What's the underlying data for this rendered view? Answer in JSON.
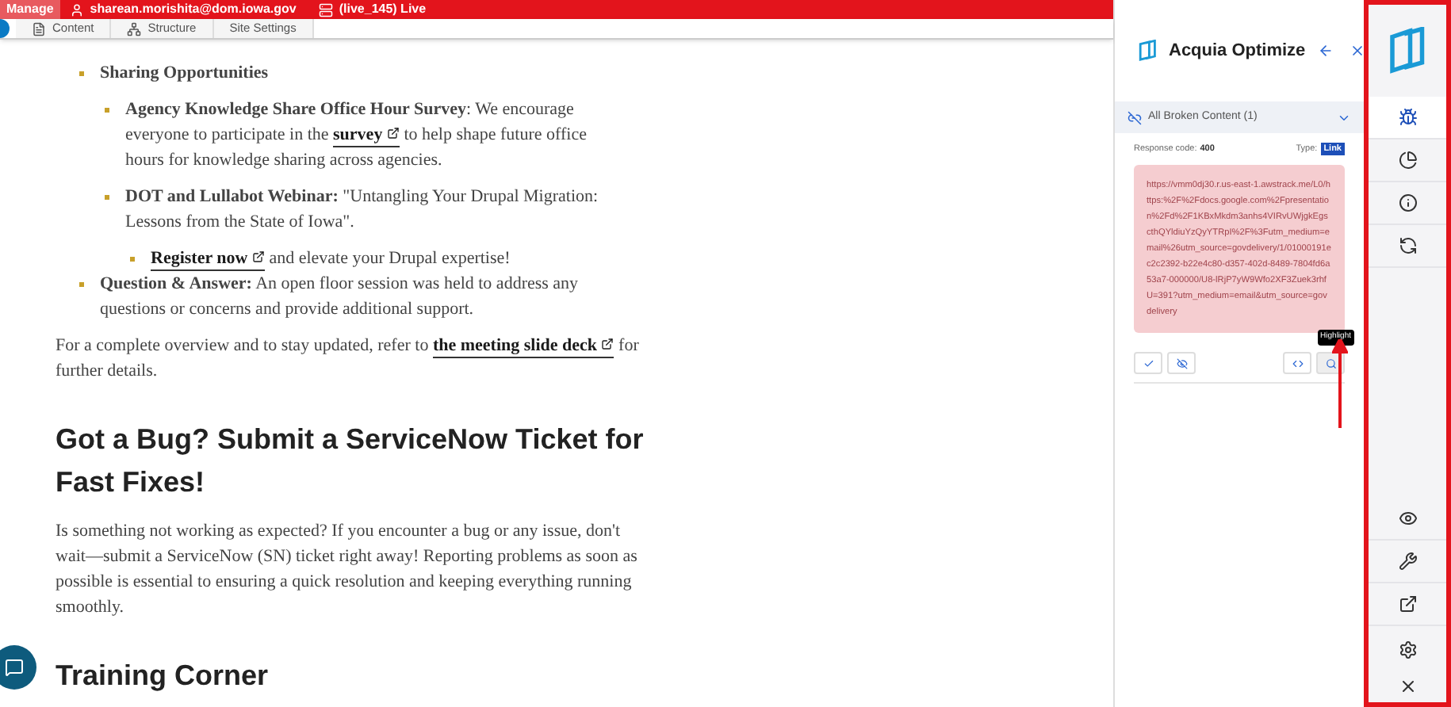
{
  "toolbar": {
    "manage": "Manage",
    "user": "sharean.morishita@dom.iowa.gov",
    "environment": "(live_145) Live",
    "tabs": [
      {
        "label": "Content"
      },
      {
        "label": "Structure"
      },
      {
        "label": "Site Settings"
      }
    ]
  },
  "article": {
    "blocks": [
      {
        "kind": "list",
        "items": [
          {
            "parts": [
              {
                "kind": "text",
                "text": "**Sharing Opportunities**"
              }
            ],
            "children": [
              {
                "parts": [
                  {
                    "kind": "text",
                    "text": "**Agency Knowledge Share Office Hour Survey**: We encourage everyone to participate in the "
                  },
                  {
                    "kind": "link",
                    "text": "survey"
                  },
                  {
                    "kind": "text",
                    "text": " to help shape future office hours for knowledge sharing across agencies."
                  }
                ]
              },
              {
                "parts": [
                  {
                    "kind": "text",
                    "text": "**DOT and Lullabot Webinar:** \"Untangling Your Drupal Migration: Lessons from the State of Iowa\"."
                  }
                ],
                "children": [
                  {
                    "parts": [
                      {
                        "kind": "link",
                        "text": "Register now"
                      },
                      {
                        "kind": "text",
                        "text": " and elevate your Drupal expertise!"
                      }
                    ]
                  }
                ]
              }
            ]
          },
          {
            "parts": [
              {
                "kind": "text",
                "text": "**Question & Answer:** An open floor session was held to address any questions or concerns and provide additional support."
              }
            ]
          }
        ]
      },
      {
        "kind": "paragraph",
        "parts": [
          {
            "kind": "text",
            "text": "For a complete overview and to stay updated, refer to "
          },
          {
            "kind": "link",
            "text": "the meeting slide deck"
          },
          {
            "kind": "text",
            "text": " for further details."
          }
        ]
      },
      {
        "kind": "heading",
        "text": "Got a Bug? Submit a ServiceNow Ticket for Fast Fixes!"
      },
      {
        "kind": "paragraph",
        "parts": [
          {
            "kind": "text",
            "text": "Is something not working as expected? If you encounter a bug or any issue, don't wait—submit a ServiceNow (SN) ticket right away! Reporting problems as soon as possible is essential to ensuring a quick resolution and keeping everything running smoothly."
          }
        ]
      },
      {
        "kind": "heading",
        "text": "Training Corner"
      }
    ]
  },
  "panel": {
    "title": "Acquia Optimize",
    "filter": "All Broken Content (1)",
    "response_label": "Response code:",
    "response_code": "400",
    "type_label": "Type:",
    "type": "Link",
    "url": "https://vmm0dj30.r.us-east-1.awstrack.me/L0/https:%2F%2Fdocs.google.com%2Fpresentation%2Fd%2F1KBxMkdm3anhs4VIRvUWjgkEgscthQYldiuYzQyYTRpI%2F%3Futm_medium=email%26utm_source=govdelivery/1/01000191ec2c2392-b22e4c80-d357-402d-8489-7804fd6a53a7-000000/U8-lRjP7yW9Wfo2XF3Zuek3rhfU=391?utm_medium=email&utm_source=govdelivery",
    "tooltip": "Highlight"
  },
  "sidebar": {
    "items": [
      {
        "selected": true
      },
      {
        "selected": false
      },
      {
        "selected": false
      },
      {
        "selected": false
      }
    ]
  }
}
